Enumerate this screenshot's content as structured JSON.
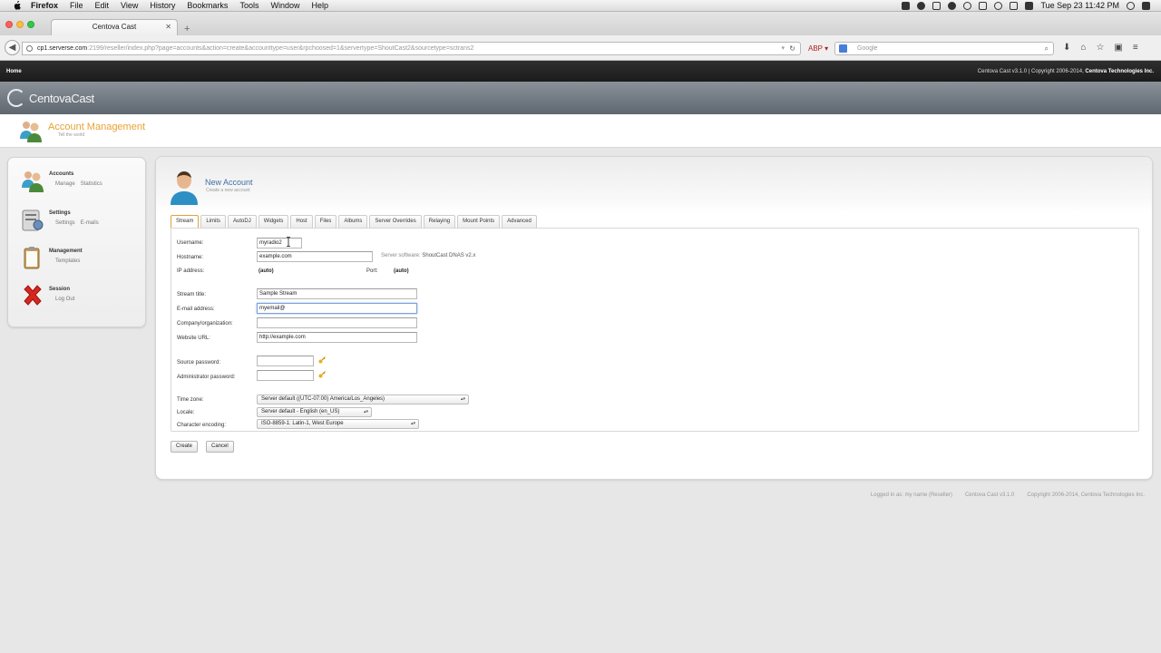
{
  "menubar": {
    "app": "Firefox",
    "items": [
      "File",
      "Edit",
      "View",
      "History",
      "Bookmarks",
      "Tools",
      "Window",
      "Help"
    ],
    "clock": "Tue Sep 23  11:42 PM"
  },
  "browser": {
    "tab_title": "Centova Cast",
    "url_host": "cp1.serverse.com",
    "url_rest": ":2199/reseller/index.php?page=accounts&action=create&accounttype=user&rpchoosed=1&servertype=ShoutCast2&sourcetype=sctrans2",
    "search_placeholder": "Google"
  },
  "header": {
    "home": "Home",
    "copyright_prefix": "Centova Cast v3.1.0 | Copyright 2006-2014, ",
    "copyright_company": "Centova Technologies Inc.",
    "brand": "CentovaCast",
    "section_title": "Account Management",
    "section_sub": "Tell the world"
  },
  "sidebar": {
    "items": [
      {
        "title": "Accounts",
        "links": [
          "Manage",
          "Statistics"
        ]
      },
      {
        "title": "Settings",
        "links": [
          "Settings",
          "E-mails"
        ]
      },
      {
        "title": "Management",
        "links": [
          "Templates"
        ]
      },
      {
        "title": "Session",
        "links": [
          "Log Out"
        ]
      }
    ]
  },
  "main": {
    "title": "New Account",
    "subtitle": "Create a new account",
    "tabs": [
      "Stream",
      "Limits",
      "AutoDJ",
      "Widgets",
      "Host",
      "Files",
      "Albums",
      "Server Overrides",
      "Relaying",
      "Mount Points",
      "Advanced"
    ],
    "active_tab": "Stream",
    "form": {
      "username_label": "Username:",
      "username_value": "myradio2",
      "hostname_label": "Hostname:",
      "hostname_value": "example.com",
      "server_software_label": "Server software:",
      "server_software_value": "ShoutCast DNAS v2.x",
      "ip_label": "IP address:",
      "ip_value": "(auto)",
      "port_label": "Port:",
      "port_value": "(auto)",
      "stream_title_label": "Stream title:",
      "stream_title_value": "Sample Stream",
      "email_label": "E-mail address:",
      "email_value": "myemail@",
      "company_label": "Company/organization:",
      "company_value": "",
      "website_label": "Website URL:",
      "website_value": "http://example.com",
      "source_pw_label": "Source password:",
      "admin_pw_label": "Administrator password:",
      "timezone_label": "Time zone:",
      "timezone_value": "Server default ((UTC-07:00) America/Los_Angeles)",
      "locale_label": "Locale:",
      "locale_value": "Server default - English (en_US)",
      "charset_label": "Character encoding:",
      "charset_value": "ISO-8859-1: Latin-1, West Europe"
    },
    "buttons": {
      "create": "Create",
      "cancel": "Cancel"
    }
  },
  "footer": {
    "logged_in": "Logged in as: my name (Reseller)",
    "version": "Centova Cast v3.1.0",
    "copyright": "Copyright 2006-2014, Centova Technologies Inc."
  },
  "colors": {
    "accent_orange": "#e8a133",
    "title_blue": "#3f6fa6",
    "topbar_dark": "#1b1b1b"
  }
}
